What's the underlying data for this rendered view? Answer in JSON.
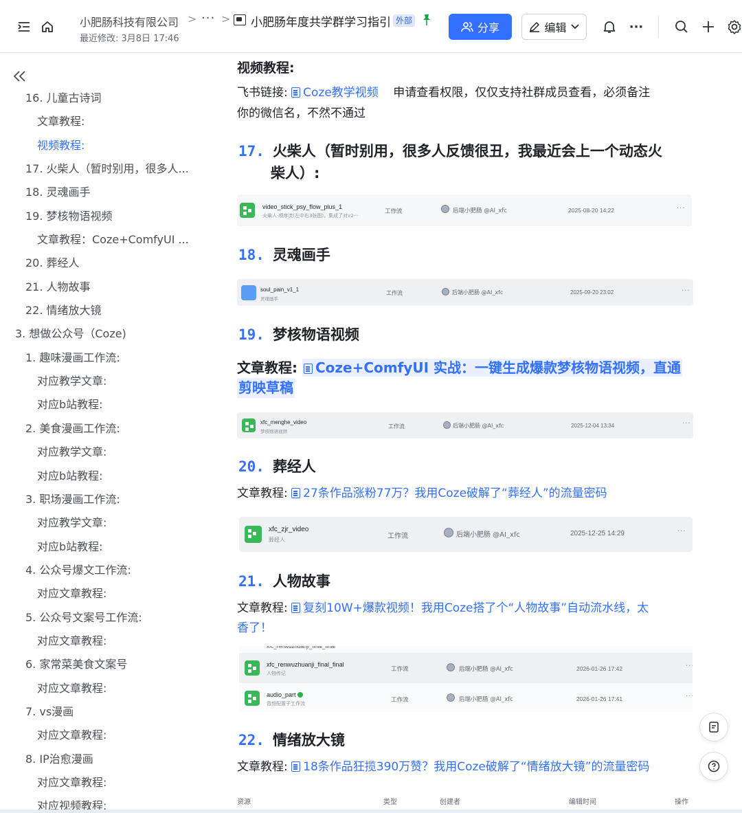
{
  "topbar": {
    "company": "小肥肠科技有限公司",
    "crumb_sep": ">",
    "crumb_more": "···",
    "last_modified": "最近修改: 3月8日 17:46",
    "doc_title": "小肥肠年度共学群学习指引",
    "external_badge": "外部",
    "share_label": "分享",
    "edit_label": "编辑",
    "more_label": "···",
    "accent": "#3370ff"
  },
  "sidebar": {
    "items": [
      {
        "level": 2,
        "label": "16. 儿童古诗词"
      },
      {
        "level": 3,
        "label": "文章教程:"
      },
      {
        "level": 3,
        "label": "视频教程:",
        "active": true
      },
      {
        "level": 2,
        "label": "17. 火柴人（暂时别用，很多人..."
      },
      {
        "level": 2,
        "label": "18. 灵魂画手"
      },
      {
        "level": 2,
        "label": "19. 梦核物语视频"
      },
      {
        "level": 3,
        "label": "文章教程：Coze+ComfyUI ..."
      },
      {
        "level": 2,
        "label": "20. 葬经人"
      },
      {
        "level": 2,
        "label": "21. 人物故事"
      },
      {
        "level": 2,
        "label": "22. 情绪放大镜"
      },
      {
        "level": 1,
        "label": "3. 想做公众号（Coze)"
      },
      {
        "level": 2,
        "label": "1. 趣味漫画工作流:"
      },
      {
        "level": 3,
        "label": "对应教学文章:"
      },
      {
        "level": 3,
        "label": "对应b站教程:"
      },
      {
        "level": 2,
        "label": "2. 美食漫画工作流:"
      },
      {
        "level": 3,
        "label": "对应教学文章:"
      },
      {
        "level": 3,
        "label": "对应b站教程:"
      },
      {
        "level": 2,
        "label": "3. 职场漫画工作流:"
      },
      {
        "level": 3,
        "label": "对应教学文章:"
      },
      {
        "level": 3,
        "label": "对应b站教程:"
      },
      {
        "level": 2,
        "label": "4. 公众号爆文工作流:"
      },
      {
        "level": 3,
        "label": "对应文章教程:"
      },
      {
        "level": 2,
        "label": "5. 公众号文案号工作流:"
      },
      {
        "level": 3,
        "label": "对应文章教程:"
      },
      {
        "level": 2,
        "label": "6. 家常菜美食文案号"
      },
      {
        "level": 3,
        "label": "对应文章教程:"
      },
      {
        "level": 2,
        "label": "7. vs漫画"
      },
      {
        "level": 3,
        "label": "对应文章教程:"
      },
      {
        "level": 2,
        "label": "8. IP治愈漫画"
      },
      {
        "level": 3,
        "label": "对应文章教程:"
      },
      {
        "level": 3,
        "label": "对应视频教程:"
      }
    ]
  },
  "main": {
    "video_heading": "视频教程:",
    "feishu_prefix": "飞书链接:",
    "feishu_link": "Coze教学视频",
    "feishu_note_1": "申请查看权限，仅仅支持社群成员查看，必须备注",
    "feishu_note_2": "你的微信名，不然不通过",
    "s17": {
      "num": "17.",
      "title_1": "火柴人（暂时别用，很多人反馈很丑，我最近会上一个动态火",
      "title_2": "柴人）:"
    },
    "card17": {
      "name": "video_stick_psy_flow_plus_1",
      "sub": "火柴人·顺序流(左中右3张图)，集成了对v2···",
      "type": "工作流",
      "creator": "后端小肥肠 @AI_xfc",
      "time": "2025-08-20 14:22",
      "more": "···"
    },
    "s18": {
      "num": "18.",
      "title": "灵魂画手"
    },
    "card18": {
      "name": "soul_pain_v1_1",
      "sub": "灵魂画手",
      "type": "工作流",
      "creator": "后端小肥肠 @AI_xfc",
      "time": "2025-09-20 23:02",
      "more": "···"
    },
    "s19": {
      "num": "19.",
      "title": "梦核物语视频"
    },
    "s19_prefix": "文章教程:",
    "s19_link_1": "Coze+ComfyUI 实战：一键生成爆款梦核物语视频，直通",
    "s19_link_2": "剪映草稿",
    "card19": {
      "name": "xfc_menghe_video",
      "sub": "梦核物语视频",
      "type": "工作流",
      "creator": "后端小肥肠 @AI_xfc",
      "time": "2025-12-04 13:34",
      "more": "···"
    },
    "s20": {
      "num": "20.",
      "title": "葬经人"
    },
    "s20_prefix": "文章教程:",
    "s20_link": "27条作品涨粉77万？我用Coze破解了“葬经人”的流量密码",
    "card20": {
      "name": "xfc_zjr_video",
      "sub": "葬经人",
      "type": "工作流",
      "creator": "后端小肥肠 @AI_xfc",
      "time": "2025-12-25 14:29",
      "more": "···"
    },
    "s21": {
      "num": "21.",
      "title": "人物故事"
    },
    "s21_prefix": "文章教程:",
    "s21_link_1": "复刻10W+爆款视频！我用Coze搭了个“人物故事”自动流水线，太",
    "s21_link_2": "香了！",
    "card21_tooltip": "xfc_renwuzhuanji_final_final",
    "card21a": {
      "name": "xfc_renwuzhuanji_final_final",
      "sub": "人物传记",
      "type": "工作流",
      "creator": "后端小肥肠 @AI_xfc",
      "time": "2026-01-26 17:42",
      "more": "···"
    },
    "card21b": {
      "name": "audio_part",
      "sub": "音频配置子工作流",
      "type": "工作流",
      "creator": "后端小肥肠 @AI_xfc",
      "time": "2026-01-26 17:41",
      "more": "···"
    },
    "s22": {
      "num": "22.",
      "title": "情绪放大镜"
    },
    "s22_prefix": "文章教程:",
    "s22_link": "18条作品狂揽390万赞？我用Coze破解了“情绪放大镜”的流量密码",
    "table_header": {
      "resource": "资源",
      "type": "类型",
      "creator": "创建者",
      "edit_time": "编辑时间",
      "action": "操作"
    }
  }
}
